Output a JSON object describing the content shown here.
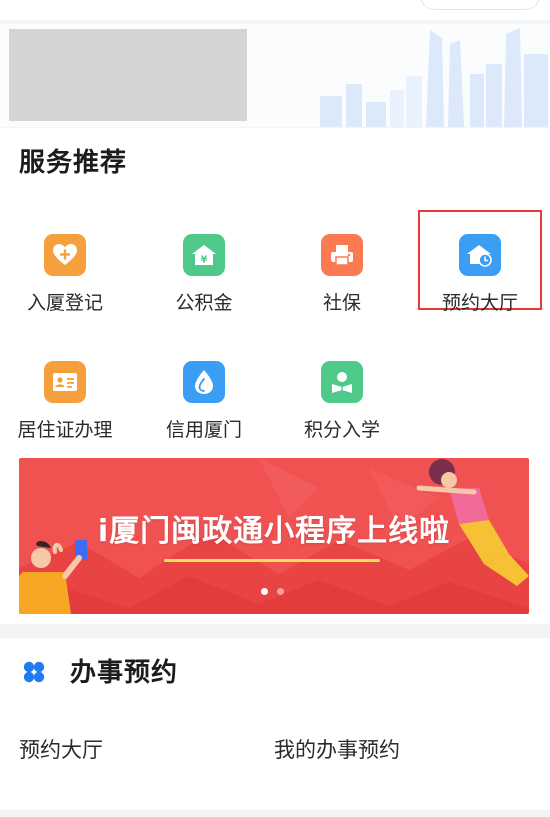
{
  "services": {
    "title": "服务推荐",
    "items": [
      {
        "label": "入厦登记",
        "icon": "heart-plus-icon",
        "color": "#f5a03c"
      },
      {
        "label": "公积金",
        "icon": "house-yen-icon",
        "color": "#4ec98a"
      },
      {
        "label": "社保",
        "icon": "printer-icon",
        "color": "#fb7a52"
      },
      {
        "label": "预约大厅",
        "icon": "home-clock-icon",
        "color": "#3a9ef5"
      },
      {
        "label": "居住证办理",
        "icon": "id-card-icon",
        "color": "#f5a03c"
      },
      {
        "label": "信用厦门",
        "icon": "droplet-icon",
        "color": "#3a9ef5"
      },
      {
        "label": "积分入学",
        "icon": "student-reading-icon",
        "color": "#4ec98a"
      }
    ]
  },
  "banner": {
    "title": "i厦门闽政通小程序上线啦",
    "dots": 2,
    "active_dot": 0
  },
  "appointment": {
    "title": "办事预约",
    "links": [
      "预约大厅",
      "我的办事预约"
    ]
  },
  "colors": {
    "accent_red": "#e53935",
    "banner_red": "#f05252",
    "brand_blue": "#1d7cf2"
  }
}
